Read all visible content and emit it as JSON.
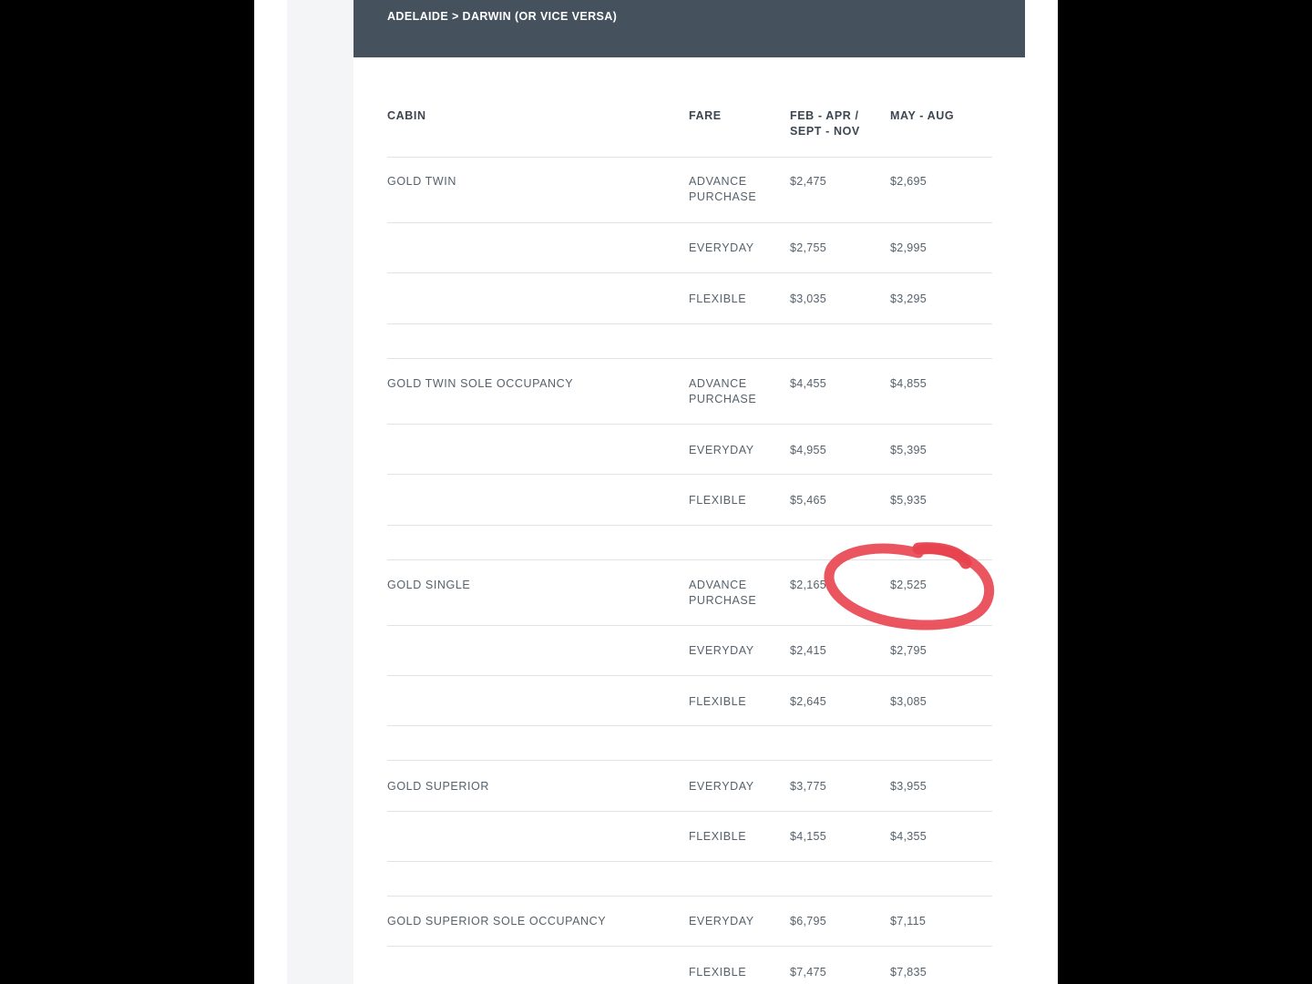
{
  "route": {
    "title": "ADELAIDE > DARWIN (OR VICE VERSA)"
  },
  "table": {
    "headers": {
      "cabin": "CABIN",
      "fare": "FARE",
      "season1_line1": "FEB - APR /",
      "season1_line2": "SEPT - NOV",
      "season2": "MAY - AUG"
    },
    "rows": [
      {
        "cabin": "GOLD TWIN",
        "fare": [
          "ADVANCE",
          "PURCHASE"
        ],
        "p1": "$2,475",
        "p2": "$2,695"
      },
      {
        "cabin": "",
        "fare": [
          "EVERYDAY"
        ],
        "p1": "$2,755",
        "p2": "$2,995"
      },
      {
        "cabin": "",
        "fare": [
          "FLEXIBLE"
        ],
        "p1": "$3,035",
        "p2": "$3,295"
      },
      {
        "cabin": "GOLD TWIN SOLE OCCUPANCY",
        "fare": [
          "ADVANCE",
          "PURCHASE"
        ],
        "p1": "$4,455",
        "p2": "$4,855"
      },
      {
        "cabin": "",
        "fare": [
          "EVERYDAY"
        ],
        "p1": "$4,955",
        "p2": "$5,395"
      },
      {
        "cabin": "",
        "fare": [
          "FLEXIBLE"
        ],
        "p1": "$5,465",
        "p2": "$5,935"
      },
      {
        "cabin": "GOLD SINGLE",
        "fare": [
          "ADVANCE",
          "PURCHASE"
        ],
        "p1": "$2,165",
        "p2": "$2,525"
      },
      {
        "cabin": "",
        "fare": [
          "EVERYDAY"
        ],
        "p1": "$2,415",
        "p2": "$2,795"
      },
      {
        "cabin": "",
        "fare": [
          "FLEXIBLE"
        ],
        "p1": "$2,645",
        "p2": "$3,085"
      },
      {
        "cabin": "GOLD SUPERIOR",
        "fare": [
          "EVERYDAY"
        ],
        "p1": "$3,775",
        "p2": "$3,955"
      },
      {
        "cabin": "",
        "fare": [
          "FLEXIBLE"
        ],
        "p1": "$4,155",
        "p2": "$4,355"
      },
      {
        "cabin": "GOLD SUPERIOR SOLE OCCUPANCY",
        "fare": [
          "EVERYDAY"
        ],
        "p1": "$6,795",
        "p2": "$7,115"
      },
      {
        "cabin": "",
        "fare": [
          "FLEXIBLE"
        ],
        "p1": "$7,475",
        "p2": "$7,835"
      }
    ]
  },
  "annotation": {
    "type": "hand-drawn circle",
    "color": "#e8434f",
    "target": "GOLD SINGLE / ADVANCE PURCHASE / MAY - AUG"
  }
}
